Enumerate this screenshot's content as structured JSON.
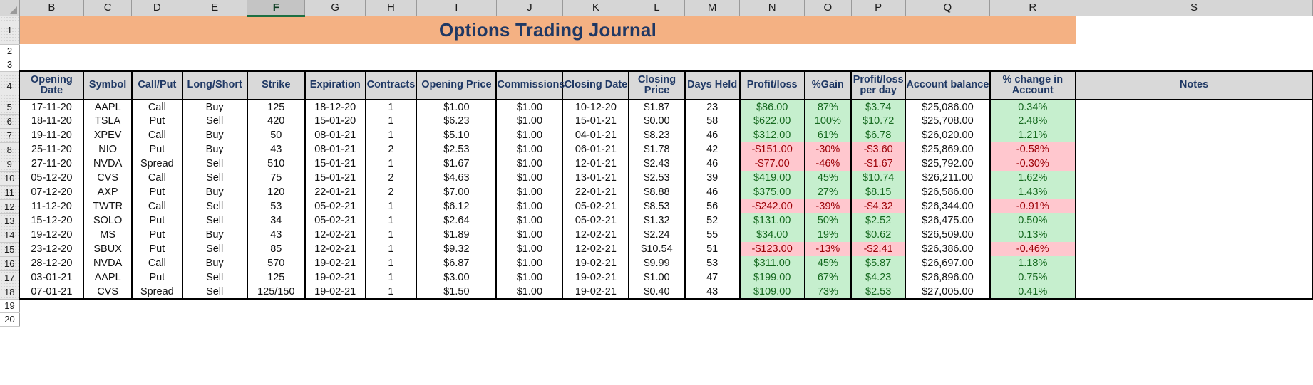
{
  "app": {
    "type": "spreadsheet",
    "selected_column": "F"
  },
  "column_letters": [
    "B",
    "C",
    "D",
    "E",
    "F",
    "G",
    "H",
    "I",
    "J",
    "K",
    "L",
    "M",
    "N",
    "O",
    "P",
    "Q",
    "R",
    "S"
  ],
  "row_numbers": [
    "1",
    "2",
    "3",
    "4",
    "5",
    "6",
    "7",
    "8",
    "9",
    "10",
    "11",
    "12",
    "13",
    "14",
    "15",
    "16",
    "17",
    "18",
    "19",
    "20"
  ],
  "title": "Options Trading Journal",
  "colors": {
    "title_band": "#f4b183",
    "title_text": "#1f3864",
    "header_fill": "#d9d9d9",
    "header_text": "#1f3864",
    "positive_fill": "#c6efce",
    "positive_text": "#16691f",
    "negative_fill": "#ffc7ce",
    "negative_text": "#9c0006",
    "selected_tab": "#1d6f42"
  },
  "table": {
    "headers": [
      "Opening Date",
      "Symbol",
      "Call/Put",
      "Long/Short",
      "Strike",
      "Expiration",
      "Contracts",
      "Opening Price",
      "Commissions",
      "Closing Date",
      "Closing Price",
      "Days Held",
      "Profit/loss",
      "%Gain",
      "Profit/loss per day",
      "Account balance",
      "% change in Account",
      "Notes"
    ],
    "rows": [
      {
        "opening_date": "17-11-20",
        "symbol": "AAPL",
        "call_put": "Call",
        "long_short": "Buy",
        "strike": "125",
        "expiration": "18-12-20",
        "contracts": "1",
        "opening_price": "$1.00",
        "commissions": "$1.00",
        "closing_date": "10-12-20",
        "closing_price": "$1.87",
        "days_held": "23",
        "profit_loss": "$86.00",
        "pct_gain": "87%",
        "pl_per_day": "$3.74",
        "account_balance": "$25,086.00",
        "pct_change_account": "0.34%",
        "notes": "",
        "sign": "pos"
      },
      {
        "opening_date": "18-11-20",
        "symbol": "TSLA",
        "call_put": "Put",
        "long_short": "Sell",
        "strike": "420",
        "expiration": "15-01-20",
        "contracts": "1",
        "opening_price": "$6.23",
        "commissions": "$1.00",
        "closing_date": "15-01-21",
        "closing_price": "$0.00",
        "days_held": "58",
        "profit_loss": "$622.00",
        "pct_gain": "100%",
        "pl_per_day": "$10.72",
        "account_balance": "$25,708.00",
        "pct_change_account": "2.48%",
        "notes": "",
        "sign": "pos"
      },
      {
        "opening_date": "19-11-20",
        "symbol": "XPEV",
        "call_put": "Call",
        "long_short": "Buy",
        "strike": "50",
        "expiration": "08-01-21",
        "contracts": "1",
        "opening_price": "$5.10",
        "commissions": "$1.00",
        "closing_date": "04-01-21",
        "closing_price": "$8.23",
        "days_held": "46",
        "profit_loss": "$312.00",
        "pct_gain": "61%",
        "pl_per_day": "$6.78",
        "account_balance": "$26,020.00",
        "pct_change_account": "1.21%",
        "notes": "",
        "sign": "pos"
      },
      {
        "opening_date": "25-11-20",
        "symbol": "NIO",
        "call_put": "Put",
        "long_short": "Buy",
        "strike": "43",
        "expiration": "08-01-21",
        "contracts": "2",
        "opening_price": "$2.53",
        "commissions": "$1.00",
        "closing_date": "06-01-21",
        "closing_price": "$1.78",
        "days_held": "42",
        "profit_loss": "-$151.00",
        "pct_gain": "-30%",
        "pl_per_day": "-$3.60",
        "account_balance": "$25,869.00",
        "pct_change_account": "-0.58%",
        "notes": "",
        "sign": "neg"
      },
      {
        "opening_date": "27-11-20",
        "symbol": "NVDA",
        "call_put": "Spread",
        "long_short": "Sell",
        "strike": "510",
        "expiration": "15-01-21",
        "contracts": "1",
        "opening_price": "$1.67",
        "commissions": "$1.00",
        "closing_date": "12-01-21",
        "closing_price": "$2.43",
        "days_held": "46",
        "profit_loss": "-$77.00",
        "pct_gain": "-46%",
        "pl_per_day": "-$1.67",
        "account_balance": "$25,792.00",
        "pct_change_account": "-0.30%",
        "notes": "",
        "sign": "neg"
      },
      {
        "opening_date": "05-12-20",
        "symbol": "CVS",
        "call_put": "Call",
        "long_short": "Sell",
        "strike": "75",
        "expiration": "15-01-21",
        "contracts": "2",
        "opening_price": "$4.63",
        "commissions": "$1.00",
        "closing_date": "13-01-21",
        "closing_price": "$2.53",
        "days_held": "39",
        "profit_loss": "$419.00",
        "pct_gain": "45%",
        "pl_per_day": "$10.74",
        "account_balance": "$26,211.00",
        "pct_change_account": "1.62%",
        "notes": "",
        "sign": "pos"
      },
      {
        "opening_date": "07-12-20",
        "symbol": "AXP",
        "call_put": "Put",
        "long_short": "Buy",
        "strike": "120",
        "expiration": "22-01-21",
        "contracts": "2",
        "opening_price": "$7.00",
        "commissions": "$1.00",
        "closing_date": "22-01-21",
        "closing_price": "$8.88",
        "days_held": "46",
        "profit_loss": "$375.00",
        "pct_gain": "27%",
        "pl_per_day": "$8.15",
        "account_balance": "$26,586.00",
        "pct_change_account": "1.43%",
        "notes": "",
        "sign": "pos"
      },
      {
        "opening_date": "11-12-20",
        "symbol": "TWTR",
        "call_put": "Call",
        "long_short": "Sell",
        "strike": "53",
        "expiration": "05-02-21",
        "contracts": "1",
        "opening_price": "$6.12",
        "commissions": "$1.00",
        "closing_date": "05-02-21",
        "closing_price": "$8.53",
        "days_held": "56",
        "profit_loss": "-$242.00",
        "pct_gain": "-39%",
        "pl_per_day": "-$4.32",
        "account_balance": "$26,344.00",
        "pct_change_account": "-0.91%",
        "notes": "",
        "sign": "neg"
      },
      {
        "opening_date": "15-12-20",
        "symbol": "SOLO",
        "call_put": "Put",
        "long_short": "Sell",
        "strike": "34",
        "expiration": "05-02-21",
        "contracts": "1",
        "opening_price": "$2.64",
        "commissions": "$1.00",
        "closing_date": "05-02-21",
        "closing_price": "$1.32",
        "days_held": "52",
        "profit_loss": "$131.00",
        "pct_gain": "50%",
        "pl_per_day": "$2.52",
        "account_balance": "$26,475.00",
        "pct_change_account": "0.50%",
        "notes": "",
        "sign": "pos"
      },
      {
        "opening_date": "19-12-20",
        "symbol": "MS",
        "call_put": "Put",
        "long_short": "Buy",
        "strike": "43",
        "expiration": "12-02-21",
        "contracts": "1",
        "opening_price": "$1.89",
        "commissions": "$1.00",
        "closing_date": "12-02-21",
        "closing_price": "$2.24",
        "days_held": "55",
        "profit_loss": "$34.00",
        "pct_gain": "19%",
        "pl_per_day": "$0.62",
        "account_balance": "$26,509.00",
        "pct_change_account": "0.13%",
        "notes": "",
        "sign": "pos"
      },
      {
        "opening_date": "23-12-20",
        "symbol": "SBUX",
        "call_put": "Put",
        "long_short": "Sell",
        "strike": "85",
        "expiration": "12-02-21",
        "contracts": "1",
        "opening_price": "$9.32",
        "commissions": "$1.00",
        "closing_date": "12-02-21",
        "closing_price": "$10.54",
        "days_held": "51",
        "profit_loss": "-$123.00",
        "pct_gain": "-13%",
        "pl_per_day": "-$2.41",
        "account_balance": "$26,386.00",
        "pct_change_account": "-0.46%",
        "notes": "",
        "sign": "neg"
      },
      {
        "opening_date": "28-12-20",
        "symbol": "NVDA",
        "call_put": "Call",
        "long_short": "Buy",
        "strike": "570",
        "expiration": "19-02-21",
        "contracts": "1",
        "opening_price": "$6.87",
        "commissions": "$1.00",
        "closing_date": "19-02-21",
        "closing_price": "$9.99",
        "days_held": "53",
        "profit_loss": "$311.00",
        "pct_gain": "45%",
        "pl_per_day": "$5.87",
        "account_balance": "$26,697.00",
        "pct_change_account": "1.18%",
        "notes": "",
        "sign": "pos"
      },
      {
        "opening_date": "03-01-21",
        "symbol": "AAPL",
        "call_put": "Put",
        "long_short": "Sell",
        "strike": "125",
        "expiration": "19-02-21",
        "contracts": "1",
        "opening_price": "$3.00",
        "commissions": "$1.00",
        "closing_date": "19-02-21",
        "closing_price": "$1.00",
        "days_held": "47",
        "profit_loss": "$199.00",
        "pct_gain": "67%",
        "pl_per_day": "$4.23",
        "account_balance": "$26,896.00",
        "pct_change_account": "0.75%",
        "notes": "",
        "sign": "pos"
      },
      {
        "opening_date": "07-01-21",
        "symbol": "CVS",
        "call_put": "Spread",
        "long_short": "Sell",
        "strike": "125/150",
        "expiration": "19-02-21",
        "contracts": "1",
        "opening_price": "$1.50",
        "commissions": "$1.00",
        "closing_date": "19-02-21",
        "closing_price": "$0.40",
        "days_held": "43",
        "profit_loss": "$109.00",
        "pct_gain": "73%",
        "pl_per_day": "$2.53",
        "account_balance": "$27,005.00",
        "pct_change_account": "0.41%",
        "notes": "",
        "sign": "pos"
      }
    ]
  }
}
